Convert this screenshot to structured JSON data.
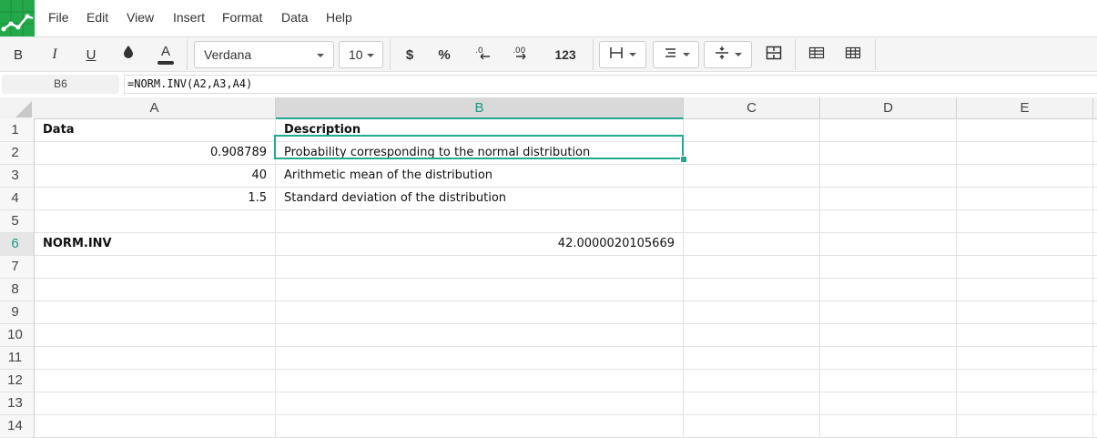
{
  "menu": [
    "File",
    "Edit",
    "View",
    "Insert",
    "Format",
    "Data",
    "Help"
  ],
  "toolbar": {
    "bold": "B",
    "italic": "I",
    "underline": "U",
    "text_color": "A",
    "font_name": "Verdana",
    "font_size": "10",
    "currency": "$",
    "percent": "%",
    "number_format": "123"
  },
  "formula_bar": {
    "cell_ref": "B6",
    "formula": "=NORM.INV(A2,A3,A4)"
  },
  "columns": [
    "A",
    "B",
    "C",
    "D",
    "E"
  ],
  "rows": [
    "1",
    "2",
    "3",
    "4",
    "5",
    "6",
    "7",
    "8",
    "9",
    "10",
    "11",
    "12",
    "13",
    "14"
  ],
  "cells": {
    "A1": "Data",
    "B1": "Description",
    "A2": "0.908789",
    "B2": "Probability corresponding to the normal distribution",
    "A3": "40",
    "B3": "Arithmetic mean of the distribution",
    "A4": "1.5",
    "B4": "Standard deviation of the distribution",
    "A6": "NORM.INV",
    "B6": "42.0000020105669"
  },
  "colors": {
    "accent": "#23a98f",
    "logo": "#23a94a"
  }
}
